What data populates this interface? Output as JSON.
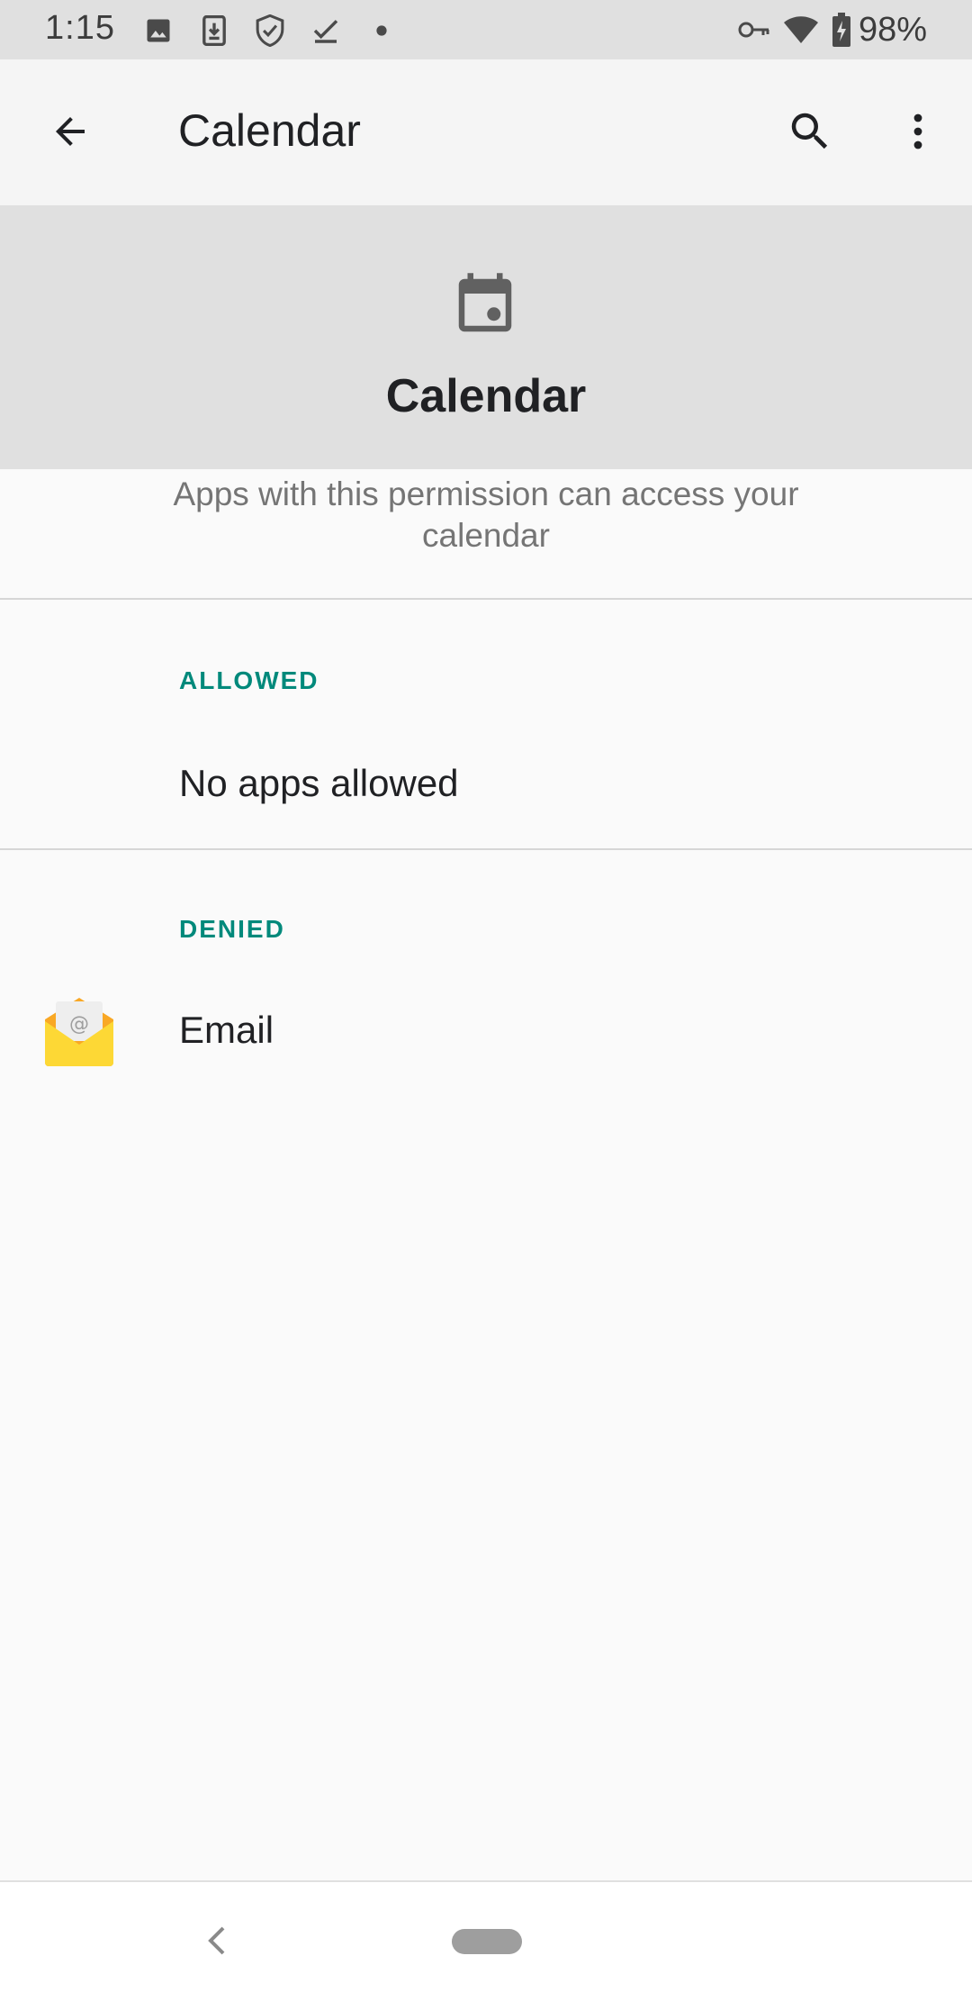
{
  "status_bar": {
    "time": "1:15",
    "battery": "98%",
    "left_icons": [
      "image-icon",
      "download-icon",
      "shield-check-icon",
      "check-icon",
      "dot-icon"
    ],
    "right_icons": [
      "vpn-key-icon",
      "wifi-icon",
      "battery-charging-icon"
    ]
  },
  "app_bar": {
    "title": "Calendar",
    "actions": [
      "back-arrow-icon",
      "search-icon",
      "more-vert-icon"
    ]
  },
  "permission": {
    "icon": "calendar-icon",
    "title": "Calendar",
    "description": "Apps with this permission can access your calendar"
  },
  "sections": {
    "allowed": {
      "label": "ALLOWED",
      "empty_text": "No apps allowed"
    },
    "denied": {
      "label": "DENIED",
      "apps": [
        {
          "name": "Email",
          "icon": "email-app-icon"
        }
      ]
    }
  },
  "nav_bar": {
    "buttons": [
      "nav-back-icon",
      "nav-home-pill"
    ]
  }
}
